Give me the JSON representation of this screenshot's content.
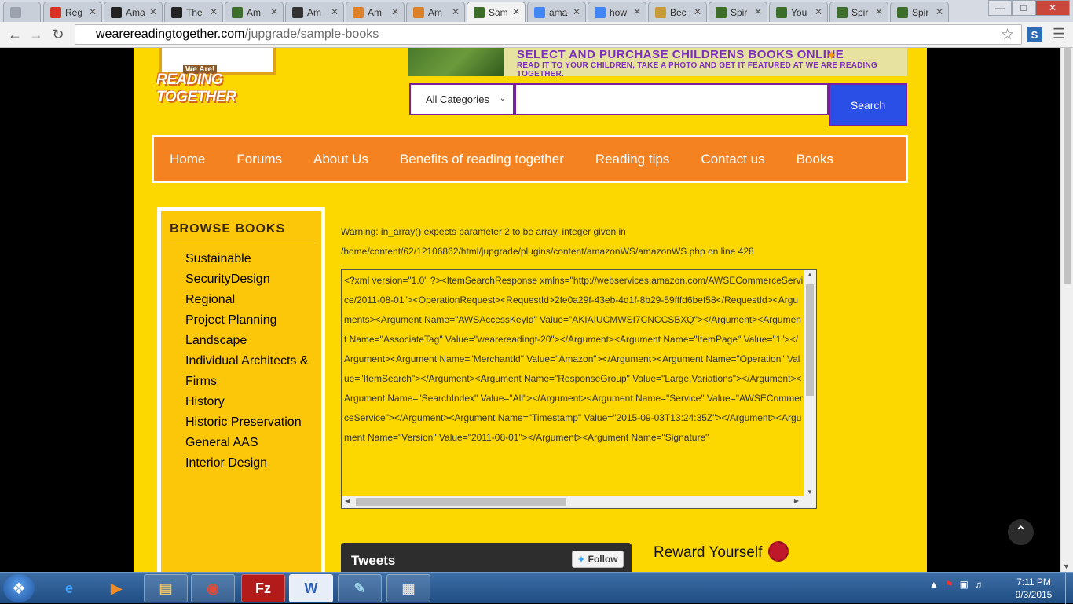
{
  "browser": {
    "tabs": [
      {
        "label": "",
        "icon": "spy-icon",
        "color": "#9aa3ae"
      },
      {
        "label": "Reg",
        "icon": "gmail-icon",
        "color": "#d93025"
      },
      {
        "label": "Ama",
        "icon": "amazon-icon",
        "color": "#222222"
      },
      {
        "label": "The",
        "icon": "amazon-icon",
        "color": "#222222"
      },
      {
        "label": "Am",
        "icon": "joomla-icon",
        "color": "#3c6e2b"
      },
      {
        "label": "Am",
        "icon": "rs-icon",
        "color": "#333333"
      },
      {
        "label": "Am",
        "icon": "joomla-icon",
        "color": "#d9822b"
      },
      {
        "label": "Am",
        "icon": "joomla-icon",
        "color": "#d9822b"
      },
      {
        "label": "Sam",
        "icon": "joomla-icon",
        "color": "#3c6e2b",
        "active": true
      },
      {
        "label": "ama",
        "icon": "google-icon",
        "color": "#4285f4"
      },
      {
        "label": "how",
        "icon": "google-icon",
        "color": "#4285f4"
      },
      {
        "label": "Bec",
        "icon": "box-icon",
        "color": "#c49a3a"
      },
      {
        "label": "Spir",
        "icon": "joomla-icon",
        "color": "#3c6e2b"
      },
      {
        "label": "You",
        "icon": "joomla-icon",
        "color": "#3c6e2b"
      },
      {
        "label": "Spir",
        "icon": "joomla-icon",
        "color": "#3c6e2b"
      },
      {
        "label": "Spir",
        "icon": "joomla-icon",
        "color": "#3c6e2b"
      }
    ],
    "url_host": "wearereadingtogether.com",
    "url_path": "/jupgrade/sample-books"
  },
  "logo": {
    "we_are": "We Are!",
    "reading": "READING TOGETHER"
  },
  "banner": {
    "line1": "SELECT AND PURCHASE CHILDRENS BOOKS ONLINE",
    "line2": "READ IT TO YOUR CHILDREN, TAKE A PHOTO AND GET IT FEATURED AT WE ARE READING TOGETHER."
  },
  "search": {
    "category": "All Categories",
    "button": "Search",
    "value": ""
  },
  "nav": [
    "Home",
    "Forums",
    "About Us",
    "Benefits of reading together",
    "Reading tips",
    "Contact us",
    "Books"
  ],
  "sidebar": {
    "title": "BROWSE BOOKS",
    "items": [
      "Sustainable",
      "SecurityDesign",
      "Regional",
      "Project Planning",
      "Landscape",
      "Individual Architects & Firms",
      "History",
      "Historic Preservation",
      "General AAS",
      "Interior Design"
    ]
  },
  "warning": "Warning: in_array() expects parameter 2 to be array, integer given in /home/content/62/12106862/html/jupgrade/plugins/content/amazonWS/amazonWS.php on line 428",
  "xml": "<?xml version=\"1.0\" ?><ItemSearchResponse xmlns=\"http://webservices.amazon.com/AWSECommerceService/2011-08-01\"><OperationRequest><RequestId>2fe0a29f-43eb-4d1f-8b29-59fffd6bef58</RequestId><Arguments><Argument Name=\"AWSAccessKeyId\" Value=\"AKIAIUCMWSI7CNCCSBXQ\"></Argument><Argument Name=\"AssociateTag\" Value=\"wearereadingt-20\"></Argument><Argument Name=\"ItemPage\" Value=\"1\"></Argument><Argument Name=\"MerchantId\" Value=\"Amazon\"></Argument><Argument Name=\"Operation\" Value=\"ItemSearch\"></Argument><Argument Name=\"ResponseGroup\" Value=\"Large,Variations\"></Argument><Argument Name=\"SearchIndex\" Value=\"All\"></Argument><Argument Name=\"Service\" Value=\"AWSECommerceService\"></Argument><Argument Name=\"Timestamp\" Value=\"2015-09-03T13:24:35Z\"></Argument><Argument Name=\"Version\" Value=\"2011-08-01\"></Argument><Argument Name=\"Signature\"",
  "tweets": {
    "title": "Tweets",
    "follow": "Follow"
  },
  "reward": "Reward Yourself",
  "taskbar": {
    "time": "7:11 PM",
    "date": "9/3/2015"
  }
}
